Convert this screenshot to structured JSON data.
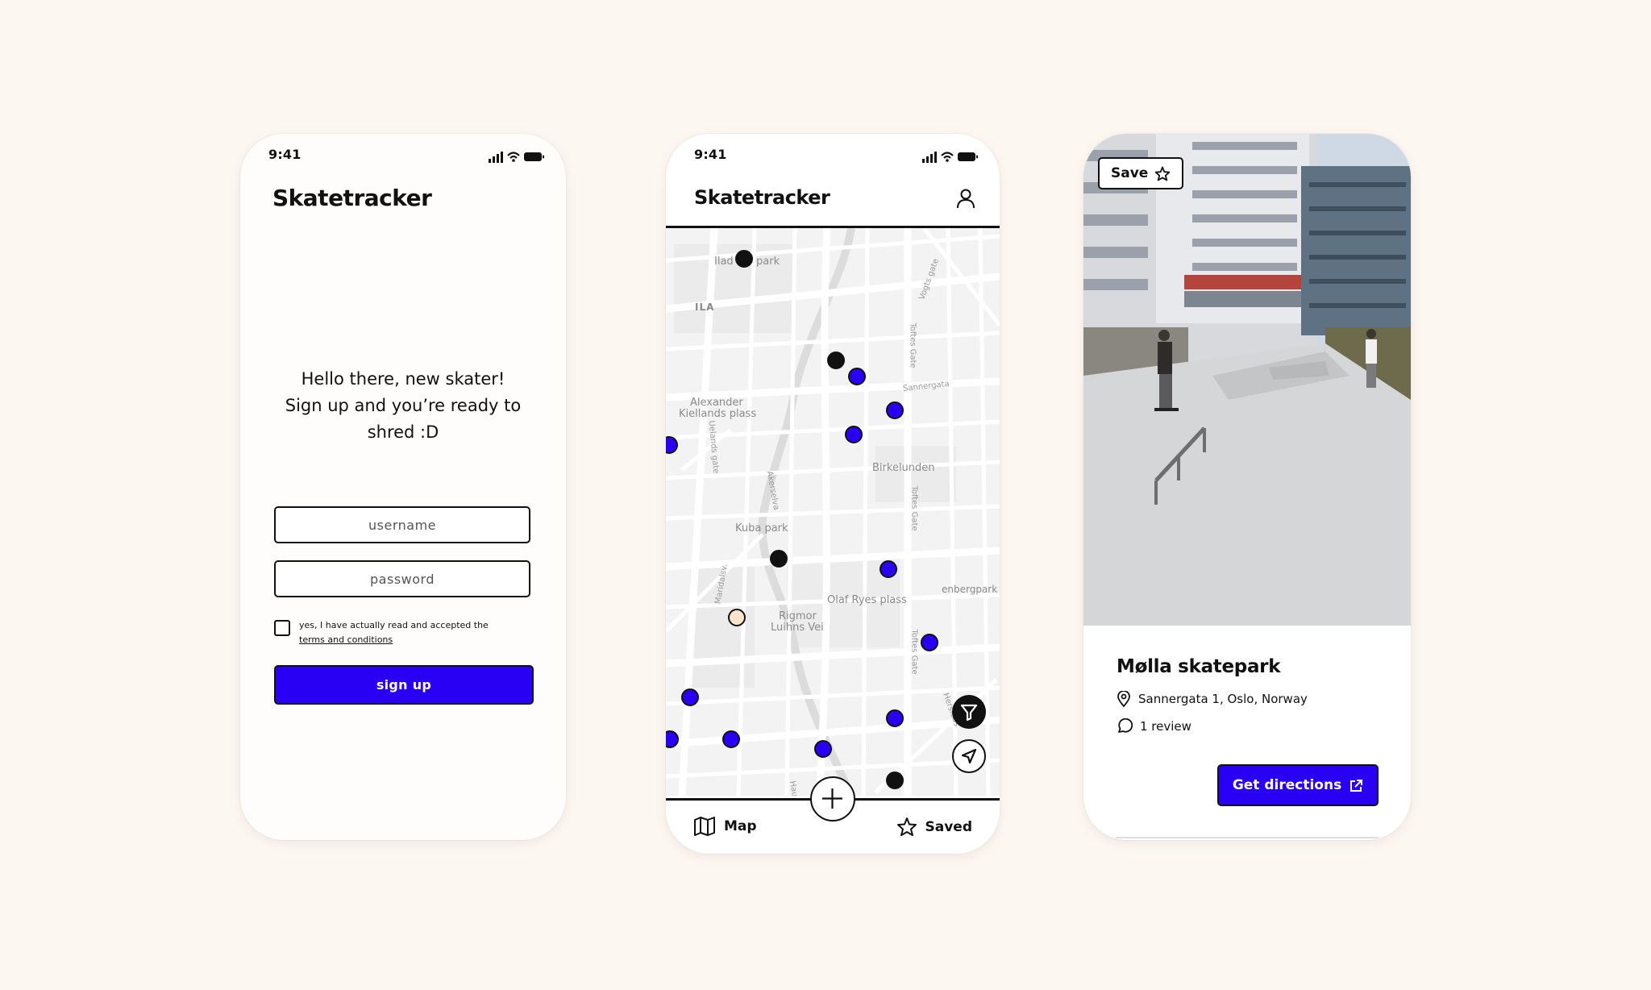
{
  "signup_screen": {
    "status_time": "9:41",
    "brand": "Skatetracker",
    "welcome_lines": [
      "Hello there, new skater!",
      "Sign up and you’re ready to",
      "shred :D"
    ],
    "username_placeholder": "username",
    "password_placeholder": "password",
    "terms_text": "yes, I have actually read and accepted the",
    "terms_link": "terms and conditions",
    "signup_label": "sign up"
  },
  "map_screen": {
    "status_time": "9:41",
    "brand": "Skatetracker",
    "profile_icon": "user-icon",
    "map_labels": {
      "ila": "ILA",
      "ila_park_left": "Ilad",
      "ila_park_right": "park",
      "alexander_1": "Alexander",
      "alexander_2": "Kiellands plass",
      "birkelunden": "Birkelunden",
      "kuba": "Kuba park",
      "olaf": "Olaf Ryes plass",
      "rigmor_1": "Rigmor",
      "rigmor_2": "Luihns Vei",
      "enberg": "enbergpark",
      "sannergata": "Sannergata",
      "toftes_1": "Toftes Gate",
      "toftes_2": "Toftes Gate",
      "toftes_3": "Toftes Gate",
      "voggs": "Vogts gate",
      "uelands": "Uelands gate",
      "akerselva": "Akerselva",
      "maridalsv": "Maridalsv.",
      "herslebs": "Herslebs",
      "hausm": "Hau"
    },
    "filter_icon": "filter-icon",
    "locate_icon": "navigation-arrow-icon",
    "add_icon": "plus-icon",
    "tab_map_label": "Map",
    "tab_saved_label": "Saved",
    "pin_colors": {
      "blue": "#2a00f5",
      "black": "#111111",
      "cream": "#fbe3cc"
    }
  },
  "detail_screen": {
    "save_label": "Save",
    "spot_name": "Mølla skatepark",
    "address": "Sannergata 1, Oslo, Norway",
    "reviews": "1 review",
    "directions_label": "Get directions",
    "accent": "#2a00f5"
  }
}
